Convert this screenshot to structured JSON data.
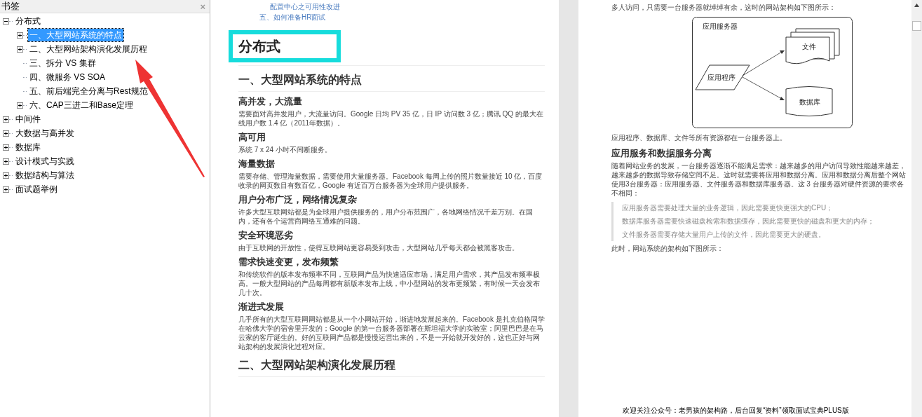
{
  "bookmarks": {
    "title": "书签",
    "close": "×",
    "tree": [
      {
        "label": "分布式",
        "kind": "folder",
        "expanded": true,
        "selected": false,
        "children": [
          {
            "label": "一、大型网站系统的特点",
            "kind": "folder",
            "expanded": false,
            "selected": true
          },
          {
            "label": "二、大型网站架构演化发展历程",
            "kind": "folder",
            "expanded": false,
            "selected": false
          },
          {
            "label": "三、拆分 VS 集群",
            "kind": "leaf",
            "selected": false
          },
          {
            "label": "四、微服务 VS SOA",
            "kind": "leaf",
            "selected": false
          },
          {
            "label": "五、前后端完全分离与Rest规范",
            "kind": "leaf",
            "selected": false
          },
          {
            "label": "六、CAP三进二和Base定理",
            "kind": "folder",
            "expanded": false,
            "selected": false
          }
        ]
      },
      {
        "label": "中间件",
        "kind": "folder",
        "expanded": false,
        "selected": false
      },
      {
        "label": "大数据与高并发",
        "kind": "folder",
        "expanded": false,
        "selected": false
      },
      {
        "label": "数据库",
        "kind": "folder",
        "expanded": false,
        "selected": false
      },
      {
        "label": "设计模式与实践",
        "kind": "folder",
        "expanded": false,
        "selected": false
      },
      {
        "label": "数据结构与算法",
        "kind": "folder",
        "expanded": false,
        "selected": false
      },
      {
        "label": "面试题举例",
        "kind": "folder",
        "expanded": false,
        "selected": false
      }
    ]
  },
  "left_page": {
    "toc_links": [
      {
        "text": "配置中心之可用性改进",
        "kind": "sub"
      },
      {
        "text": "五、如何准备HR面试",
        "kind": "top"
      }
    ],
    "blocks": [
      {
        "kind": "h1",
        "text": "分布式"
      },
      {
        "kind": "h2",
        "text": "一、大型网站系统的特点"
      },
      {
        "kind": "h3",
        "text": "高并发，大流量"
      },
      {
        "kind": "p",
        "text": "需要面对高并发用户，大流量访问。Google 日均 PV 35 亿，日 IP 访问数 3 亿；腾讯 QQ 的最大在线用户数 1.4 亿（2011年数据）。"
      },
      {
        "kind": "h3",
        "text": "高可用"
      },
      {
        "kind": "p",
        "text": "系统 7 x 24 小时不间断服务。"
      },
      {
        "kind": "h3",
        "text": "海量数据"
      },
      {
        "kind": "p",
        "text": "需要存储、管理海量数据，需要使用大量服务器。Facebook 每周上传的照片数量接近 10 亿，百度收录的网页数目有数百亿，Google 有近百万台服务器为全球用户提供服务。"
      },
      {
        "kind": "h3",
        "text": "用户分布广泛，网络情况复杂"
      },
      {
        "kind": "p",
        "text": "许多大型互联网站都是为全球用户提供服务的，用户分布范围广，各地网络情况千差万别。在国内，还有各个运营商网络互通难的问题。"
      },
      {
        "kind": "h3",
        "text": "安全环境恶劣"
      },
      {
        "kind": "p",
        "text": "由于互联网的开放性，使得互联网站更容易受到攻击，大型网站几乎每天都会被黑客攻击。"
      },
      {
        "kind": "h3",
        "text": "需求快速变更，发布频繁"
      },
      {
        "kind": "p",
        "text": "和传统软件的版本发布频率不同，互联网产品为快速适应市场，满足用户需求，其产品发布频率极高。一般大型网站的产品每周都有新版本发布上线，中小型网站的发布更频繁，有时候一天会发布几十次。"
      },
      {
        "kind": "h3",
        "text": "渐进式发展"
      },
      {
        "kind": "p",
        "text": "几乎所有的大型互联网网站都是从一个小网站开始，渐进地发展起来的。Facebook 是扎克伯格同学在哈佛大学的宿舍里开发的；Google 的第一台服务器部署在斯坦福大学的实验室；阿里巴巴是在马云家的客厅诞生的。好的互联网产品都是慢慢运营出来的，不是一开始就开发好的，这也正好与网站架构的发展演化过程对应。"
      },
      {
        "kind": "h2",
        "text": "二、大型网站架构演化发展历程"
      }
    ]
  },
  "right_page": {
    "intro": "多人访问，只需要一台服务器就绰绰有余，这时的网站架构如下图所示：",
    "diagram": {
      "server": "应用服务器",
      "app": "应用程序",
      "files": "文件",
      "database": "数据库"
    },
    "blocks": [
      {
        "kind": "p",
        "text": "应用程序、数据库、文件等所有资源都在一台服务器上。"
      },
      {
        "kind": "h3",
        "text": "应用服务和数据服务分离"
      },
      {
        "kind": "p",
        "text": "随着网站业务的发展，一台服务器逐渐不能满足需求：越来越多的用户访问导致性能越来越差，越来越多的数据导致存储空间不足。这时就需要将应用和数据分离。应用和数据分离后整个网站使用3台服务器：应用服务器、文件服务器和数据库服务器。这 3 台服务器对硬件资源的要求各不相同："
      },
      {
        "kind": "quote",
        "items": [
          "应用服务器需要处理大量的业务逻辑，因此需要更快更强大的CPU；",
          "数据库服务器需要快速磁盘检索和数据缓存，因此需要更快的磁盘和更大的内存；",
          "文件服务器需要存储大量用户上传的文件，因此需要更大的硬盘。"
        ]
      },
      {
        "kind": "p",
        "text": "此时，网站系统的架构如下图所示："
      }
    ],
    "footer": "欢迎关注公众号：老男孩的架构路，后台回复“资料”领取面试宝典PLUS版"
  }
}
